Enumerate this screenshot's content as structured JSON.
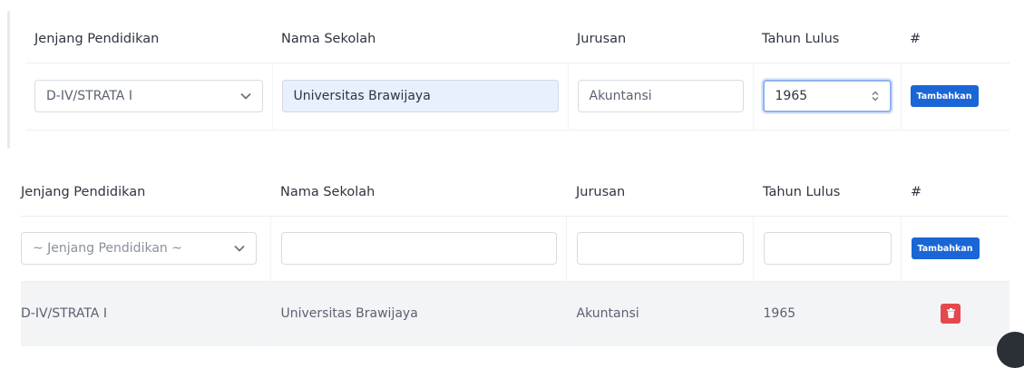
{
  "headers": {
    "level": "Jenjang Pendidikan",
    "school": "Nama Sekolah",
    "major": "Jurusan",
    "year": "Tahun Lulus",
    "action": "#"
  },
  "top_form": {
    "level_value": "D-IV/STRATA I",
    "school_value": "Universitas Brawijaya",
    "major_value": "Akuntansi",
    "year_value": "1965",
    "add_label": "Tambahkan"
  },
  "bottom_form": {
    "level_placeholder": "~ Jenjang Pendidikan ~",
    "school_value": "",
    "major_value": "",
    "year_value": "",
    "add_label": "Tambahkan"
  },
  "rows": [
    {
      "level": "D-IV/STRATA I",
      "school": "Universitas Brawijaya",
      "major": "Akuntansi",
      "year": "1965"
    }
  ],
  "colors": {
    "primary": "#1a66d6",
    "danger": "#e5484d",
    "autofill": "#e8f0fe"
  }
}
